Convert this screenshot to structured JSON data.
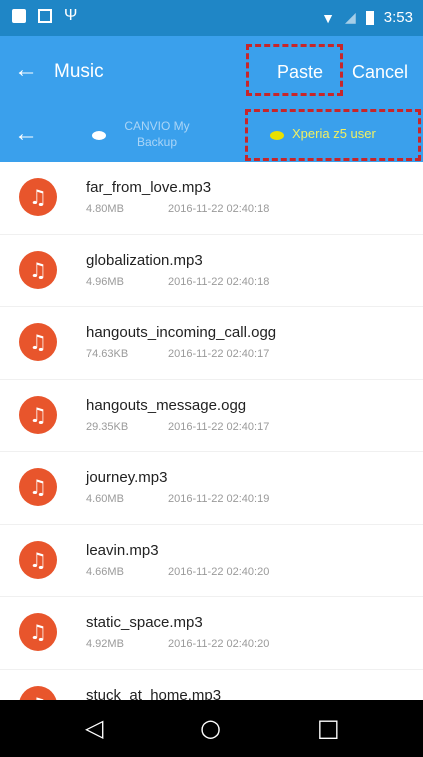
{
  "status_bar": {
    "time": "3:53",
    "icons": [
      "notification-square-icon",
      "image-icon",
      "usb-icon",
      "wifi-icon",
      "signal-icon",
      "battery-icon"
    ]
  },
  "app_bar": {
    "title": "Music",
    "paste_label": "Paste",
    "cancel_label": "Cancel"
  },
  "path_bar": {
    "crumb_source": "CANVIO My Backup",
    "crumb_dest": "Xperia z5 user"
  },
  "files": [
    {
      "name": "far_from_love.mp3",
      "size": "4.80MB",
      "date": "2016-11-22 02:40:18"
    },
    {
      "name": "globalization.mp3",
      "size": "4.96MB",
      "date": "2016-11-22 02:40:18"
    },
    {
      "name": "hangouts_incoming_call.ogg",
      "size": "74.63KB",
      "date": "2016-11-22 02:40:17"
    },
    {
      "name": "hangouts_message.ogg",
      "size": "29.35KB",
      "date": "2016-11-22 02:40:17"
    },
    {
      "name": "journey.mp3",
      "size": "4.60MB",
      "date": "2016-11-22 02:40:19"
    },
    {
      "name": "leavin.mp3",
      "size": "4.66MB",
      "date": "2016-11-22 02:40:20"
    },
    {
      "name": "static_space.mp3",
      "size": "4.92MB",
      "date": "2016-11-22 02:40:20"
    },
    {
      "name": "stuck_at_home.mp3",
      "size": "",
      "date": ""
    }
  ],
  "colors": {
    "accent": "#3aa0ec",
    "status": "#1f86c6",
    "file_icon": "#e8552c",
    "highlight": "#c7262a"
  }
}
